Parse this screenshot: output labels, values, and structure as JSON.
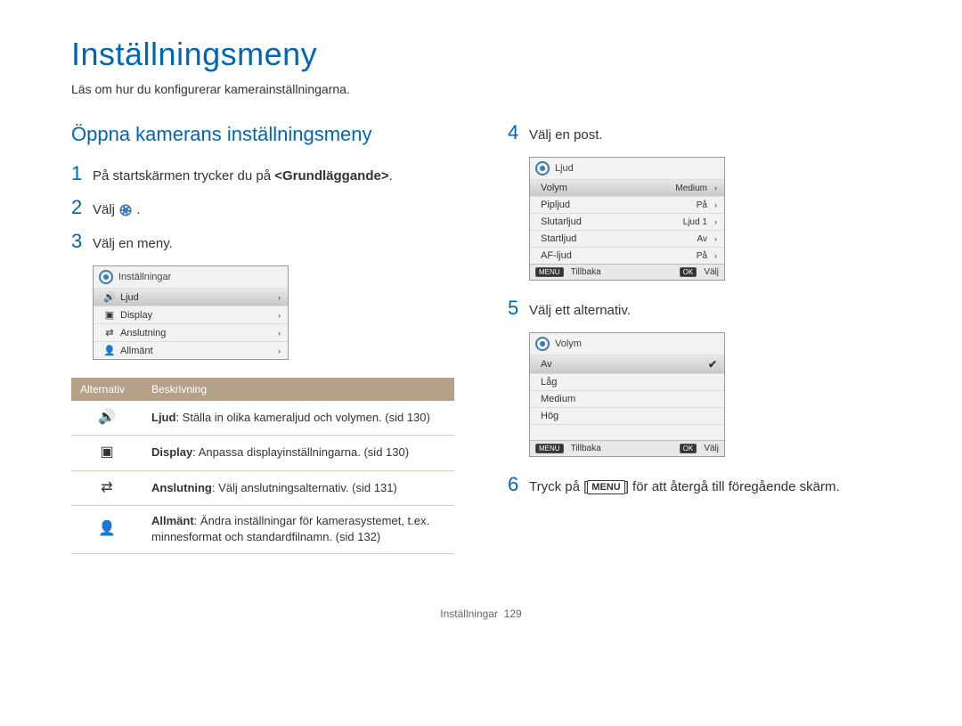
{
  "title": "Inställningsmeny",
  "intro": "Läs om hur du konfigurerar kamerainställningarna.",
  "section_heading": "Öppna kamerans inställningsmeny",
  "left": {
    "step1": {
      "num": "1",
      "pre": "På startskärmen trycker du på ",
      "bold": "<Grundläggande>",
      "post": "."
    },
    "step2": {
      "num": "2",
      "text": "Välj "
    },
    "step3": {
      "num": "3",
      "text": "Välj en meny."
    },
    "panel": {
      "header": "Inställningar",
      "rows": [
        {
          "icon": "sound-icon",
          "glyph": "🔊",
          "label": "Ljud",
          "selected": true
        },
        {
          "icon": "display-icon",
          "glyph": "▣",
          "label": "Display"
        },
        {
          "icon": "connect-icon",
          "glyph": "⇄",
          "label": "Anslutning"
        },
        {
          "icon": "general-icon",
          "glyph": "👤",
          "label": "Allmänt"
        }
      ]
    },
    "table": {
      "head_option": "Alternativ",
      "head_desc": "Beskrivning",
      "rows": [
        {
          "icon": "sound-icon",
          "glyph": "🔊",
          "bold": "Ljud",
          "text": ": Ställa in olika kameraljud och volymen. (sid 130)"
        },
        {
          "icon": "display-icon",
          "glyph": "▣",
          "bold": "Display",
          "text": ": Anpassa displayinställningarna. (sid 130)"
        },
        {
          "icon": "connect-icon",
          "glyph": "⇄",
          "bold": "Anslutning",
          "text": ": Välj anslutningsalternativ. (sid 131)"
        },
        {
          "icon": "general-icon",
          "glyph": "👤",
          "bold": "Allmänt",
          "text": ": Ändra inställningar för kamerasystemet, t.ex. minnesformat och standardfilnamn. (sid 132)"
        }
      ]
    }
  },
  "right": {
    "step4": {
      "num": "4",
      "text": "Välj en post."
    },
    "panel4": {
      "header": "Ljud",
      "rows": [
        {
          "label": "Volym",
          "value": "Medium",
          "selected": true
        },
        {
          "label": "Pipljud",
          "value": "På"
        },
        {
          "label": "Slutarljud",
          "value": "Ljud 1"
        },
        {
          "label": "Startljud",
          "value": "Av"
        },
        {
          "label": "AF-ljud",
          "value": "På"
        }
      ],
      "back": "Tillbaka",
      "select": "Välj",
      "menu_btn": "MENU",
      "ok_btn": "OK"
    },
    "step5": {
      "num": "5",
      "text": "Välj ett alternativ."
    },
    "panel5": {
      "header": "Volym",
      "rows": [
        {
          "label": "Av",
          "checked": true
        },
        {
          "label": "Låg"
        },
        {
          "label": "Medium"
        },
        {
          "label": "Hög"
        }
      ],
      "back": "Tillbaka",
      "select": "Välj",
      "menu_btn": "MENU",
      "ok_btn": "OK"
    },
    "step6": {
      "num": "6",
      "pre": "Tryck på [",
      "btn": "MENU",
      "post": "] för att återgå till föregående skärm."
    }
  },
  "footer": {
    "label": "Inställningar",
    "page": "129"
  }
}
